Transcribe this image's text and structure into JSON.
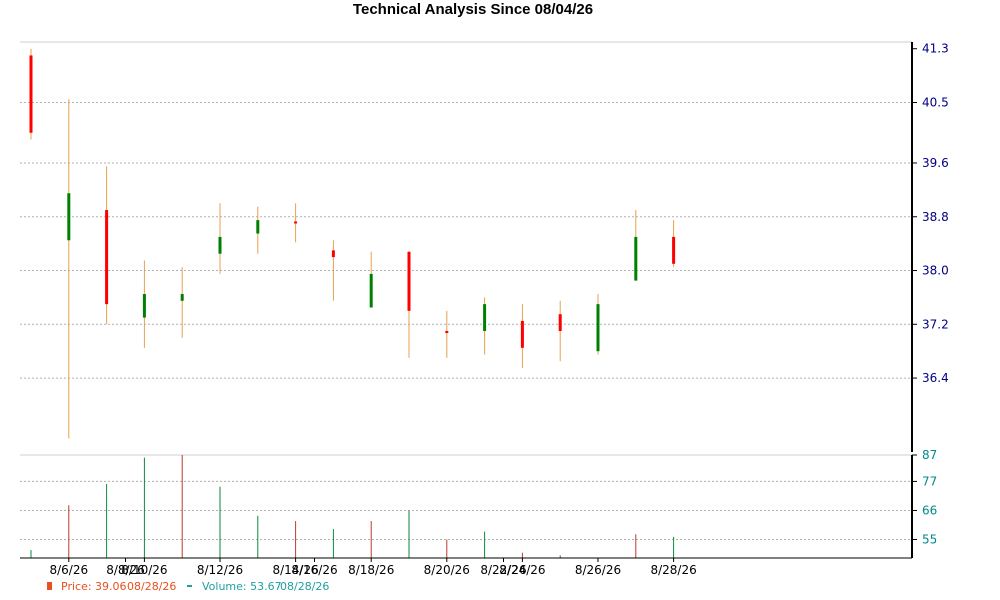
{
  "colors": {
    "up": "#008000",
    "down": "#ff0000",
    "wick": "#e8a050",
    "volume_up": "#0a8a3a",
    "volume_down": "#c0392b",
    "price_axis": "#000080",
    "volume_axis": "#008b8b",
    "price_legend": "#e8501e",
    "volume_legend": "#20a0a0",
    "grid": "#b0b0b0"
  },
  "chart_data": [
    {
      "type": "candlestick",
      "title": "Technical Analysis Since 08/04/26",
      "ylim": [
        35.3,
        41.4
      ],
      "y_ticks": [
        41.3,
        40.5,
        39.6,
        38.8,
        38.0,
        37.2,
        36.4
      ],
      "x_tick_labels": [
        "8/6/26",
        "8/8/26",
        "8/10/26",
        "8/12/26",
        "8/14/26",
        "8/16/26",
        "8/18/26",
        "8/20/26",
        "8/22/26",
        "8/24/26",
        "8/26/26",
        "8/28/26"
      ],
      "grid": true,
      "candles": [
        {
          "date": "8/5/26",
          "open": 41.2,
          "high": 41.3,
          "low": 39.95,
          "close": 40.05
        },
        {
          "date": "8/6/26",
          "open": 38.45,
          "high": 40.55,
          "low": 35.5,
          "close": 39.15
        },
        {
          "date": "8/7/26",
          "open": 38.9,
          "high": 39.55,
          "low": 37.2,
          "close": 37.5
        },
        {
          "date": "8/10/26",
          "open": 37.3,
          "high": 38.15,
          "low": 36.85,
          "close": 37.65
        },
        {
          "date": "8/11/26",
          "open": 37.55,
          "high": 38.05,
          "low": 37.0,
          "close": 37.65
        },
        {
          "date": "8/12/26",
          "open": 38.25,
          "high": 39.0,
          "low": 37.95,
          "close": 38.5
        },
        {
          "date": "8/13/26",
          "open": 38.55,
          "high": 38.95,
          "low": 38.25,
          "close": 38.75
        },
        {
          "date": "8/14/26",
          "open": 38.73,
          "high": 39.0,
          "low": 38.42,
          "close": 38.71
        },
        {
          "date": "8/17/26",
          "open": 38.3,
          "high": 38.45,
          "low": 37.55,
          "close": 38.2
        },
        {
          "date": "8/18/26",
          "open": 37.45,
          "high": 38.28,
          "low": 37.45,
          "close": 37.95
        },
        {
          "date": "8/19/26",
          "open": 38.28,
          "high": 38.28,
          "low": 36.7,
          "close": 37.4
        },
        {
          "date": "8/20/26",
          "open": 37.1,
          "high": 37.4,
          "low": 36.7,
          "close": 37.07
        },
        {
          "date": "8/21/26",
          "open": 37.1,
          "high": 37.6,
          "low": 36.75,
          "close": 37.5
        },
        {
          "date": "8/24/26",
          "open": 37.25,
          "high": 37.5,
          "low": 36.55,
          "close": 36.85
        },
        {
          "date": "8/25/26",
          "open": 37.35,
          "high": 37.55,
          "low": 36.65,
          "close": 37.1
        },
        {
          "date": "8/26/26",
          "open": 36.8,
          "high": 37.65,
          "low": 36.75,
          "close": 37.5
        },
        {
          "date": "8/27/26",
          "open": 37.85,
          "high": 38.9,
          "low": 37.85,
          "close": 38.5
        },
        {
          "date": "8/28/26",
          "open": 38.5,
          "high": 38.75,
          "low": 38.05,
          "close": 38.1
        }
      ]
    },
    {
      "type": "bar",
      "ylim": [
        48,
        87
      ],
      "y_ticks": [
        87,
        77,
        66,
        55
      ],
      "grid": true,
      "volume": [
        {
          "date": "8/5/26",
          "value": 51,
          "direction": "up"
        },
        {
          "date": "8/6/26",
          "value": 68,
          "direction": "down"
        },
        {
          "date": "8/7/26",
          "value": 76,
          "direction": "up"
        },
        {
          "date": "8/10/26",
          "value": 86,
          "direction": "up"
        },
        {
          "date": "8/11/26",
          "value": 88,
          "direction": "down"
        },
        {
          "date": "8/12/26",
          "value": 75,
          "direction": "up"
        },
        {
          "date": "8/13/26",
          "value": 64,
          "direction": "up"
        },
        {
          "date": "8/14/26",
          "value": 62,
          "direction": "down"
        },
        {
          "date": "8/17/26",
          "value": 59,
          "direction": "up"
        },
        {
          "date": "8/18/26",
          "value": 62,
          "direction": "down"
        },
        {
          "date": "8/19/26",
          "value": 66,
          "direction": "up"
        },
        {
          "date": "8/20/26",
          "value": 55,
          "direction": "down"
        },
        {
          "date": "8/21/26",
          "value": 58,
          "direction": "up"
        },
        {
          "date": "8/24/26",
          "value": 50,
          "direction": "down"
        },
        {
          "date": "8/25/26",
          "value": 49,
          "direction": "up"
        },
        {
          "date": "8/26/26",
          "value": 47,
          "direction": "up"
        },
        {
          "date": "8/27/26",
          "value": 57,
          "direction": "down"
        },
        {
          "date": "8/28/26",
          "value": 56,
          "direction": "up"
        }
      ]
    }
  ],
  "legend": {
    "price_label": "Price: 39.06",
    "price_date": "08/28/26",
    "volume_label": "Volume: 53.67",
    "volume_date": "08/28/26"
  }
}
